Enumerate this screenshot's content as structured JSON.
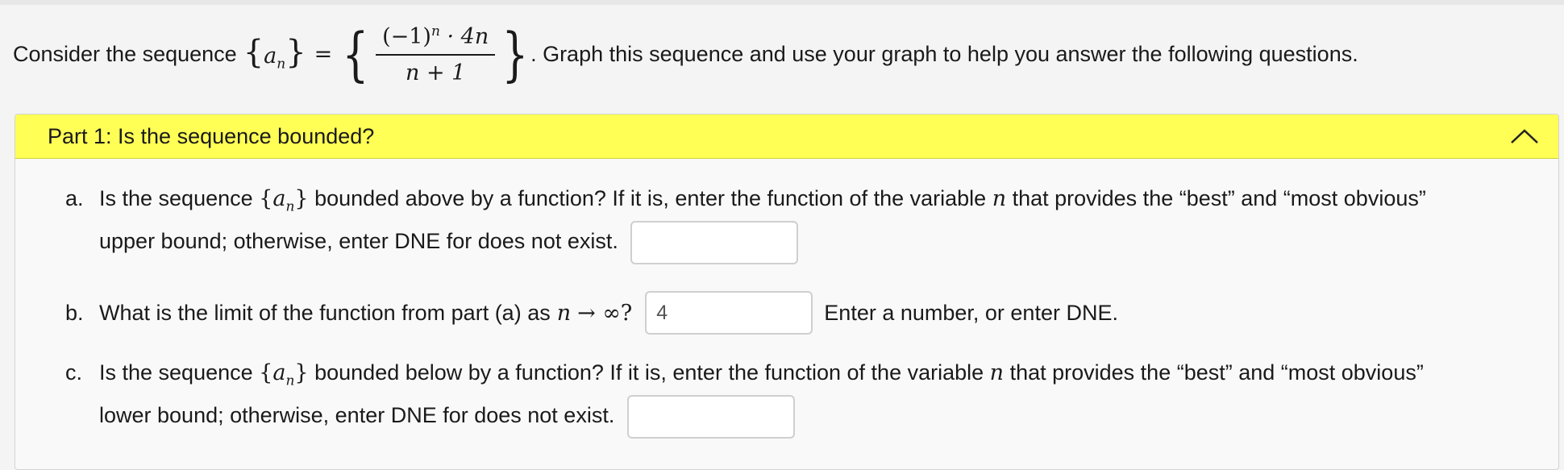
{
  "intro": {
    "prefix": "Consider the sequence",
    "seq_var": "a",
    "seq_sub": "n",
    "equals": "=",
    "numerator_base": "(−1)",
    "numerator_exp": "n",
    "numerator_rest": "· 4n",
    "denominator": "n + 1",
    "suffix": ". Graph this sequence and use your graph to help you answer the following questions."
  },
  "part1": {
    "title": "Part 1: Is the sequence bounded?",
    "chevron_icon": "chevron-up-icon",
    "qa": {
      "letter": "a.",
      "text1": "Is the sequence",
      "text2": "bounded above by a function? If it is, enter the function of the variable",
      "var": "n",
      "text3": "that provides the “best” and “most obvious”",
      "line2": "upper bound; otherwise, enter DNE for does not exist.",
      "value": ""
    },
    "qb": {
      "letter": "b.",
      "text1": "What is the limit of the function from part (a) as",
      "var": "n",
      "arrow": "→ ∞?",
      "value": "4",
      "hint": "Enter a number, or enter DNE."
    },
    "qc": {
      "letter": "c.",
      "text1": "Is the sequence",
      "text2": "bounded below by a function? If it is, enter the function of the variable",
      "var": "n",
      "text3": "that provides the “best” and “most obvious”",
      "line2": "lower bound; otherwise, enter DNE for does not exist.",
      "value": ""
    }
  }
}
